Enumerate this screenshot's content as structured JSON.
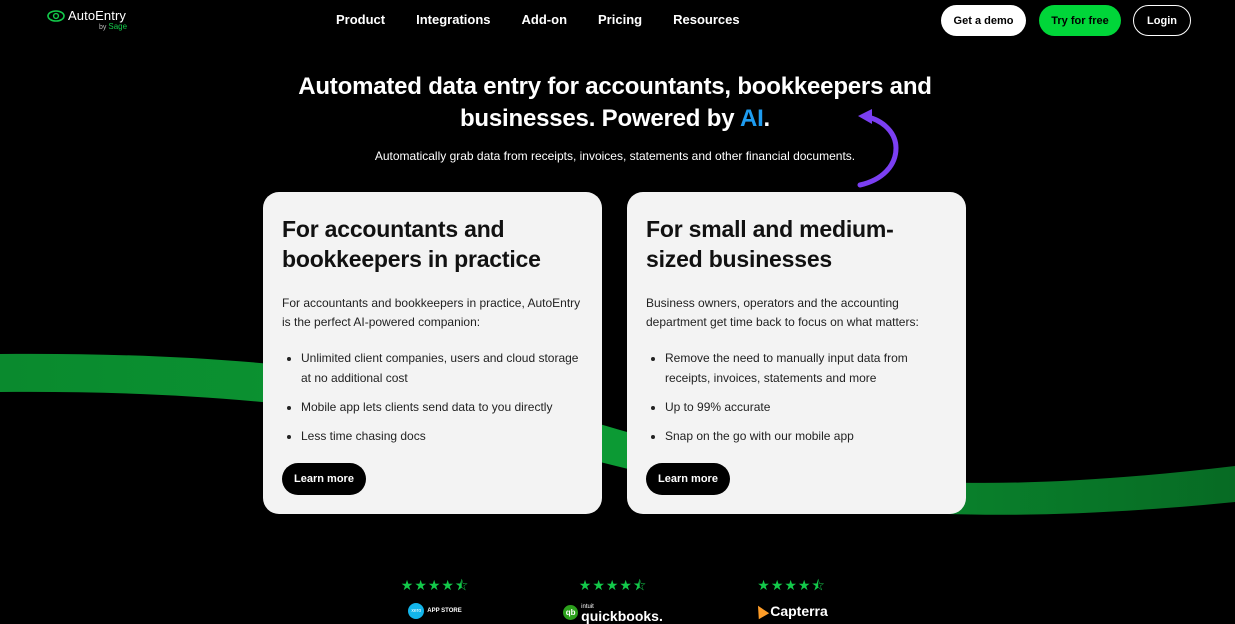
{
  "header": {
    "logo_name": "AutoEntry",
    "logo_by": "by",
    "logo_brand": "Sage",
    "nav": [
      "Product",
      "Integrations",
      "Add-on",
      "Pricing",
      "Resources"
    ],
    "get_demo": "Get a demo",
    "try_free": "Try for free",
    "login": "Login"
  },
  "hero": {
    "title_main": "Automated data entry for accountants, bookkeepers and businesses. Powered by ",
    "title_ai": "AI",
    "title_end": ".",
    "subtitle": "Automatically grab data from receipts, invoices, statements and other financial documents."
  },
  "cards": [
    {
      "heading": "For accountants and bookkeepers in practice",
      "intro": "For accountants and bookkeepers in practice, AutoEntry is the perfect AI-powered companion:",
      "bullets": [
        "Unlimited client companies, users and cloud storage at no additional cost",
        "Mobile app lets clients send data to you directly",
        "Less time chasing docs"
      ],
      "cta": "Learn more"
    },
    {
      "heading": "For small and medium-sized businesses",
      "intro": "Business owners, operators and the accounting department get time back to focus on what matters:",
      "bullets": [
        "Remove the need to manually input data from receipts, invoices, statements and more",
        "Up to 99% accurate",
        "Snap on the go with our mobile app"
      ],
      "cta": "Learn more"
    }
  ],
  "ratings": [
    {
      "stars": "★★★★⯪",
      "badge": "xero",
      "label": "APP STORE"
    },
    {
      "stars": "★★★★⯪",
      "badge_top": "intuit",
      "label": "quickbooks."
    },
    {
      "stars": "★★★★⯪",
      "label": "Capterra"
    }
  ],
  "colors": {
    "accent_green": "#00d639",
    "ai_blue": "#1e9cf0",
    "arrow_purple": "#7b3ff2",
    "card_bg": "#f3f3f3"
  }
}
